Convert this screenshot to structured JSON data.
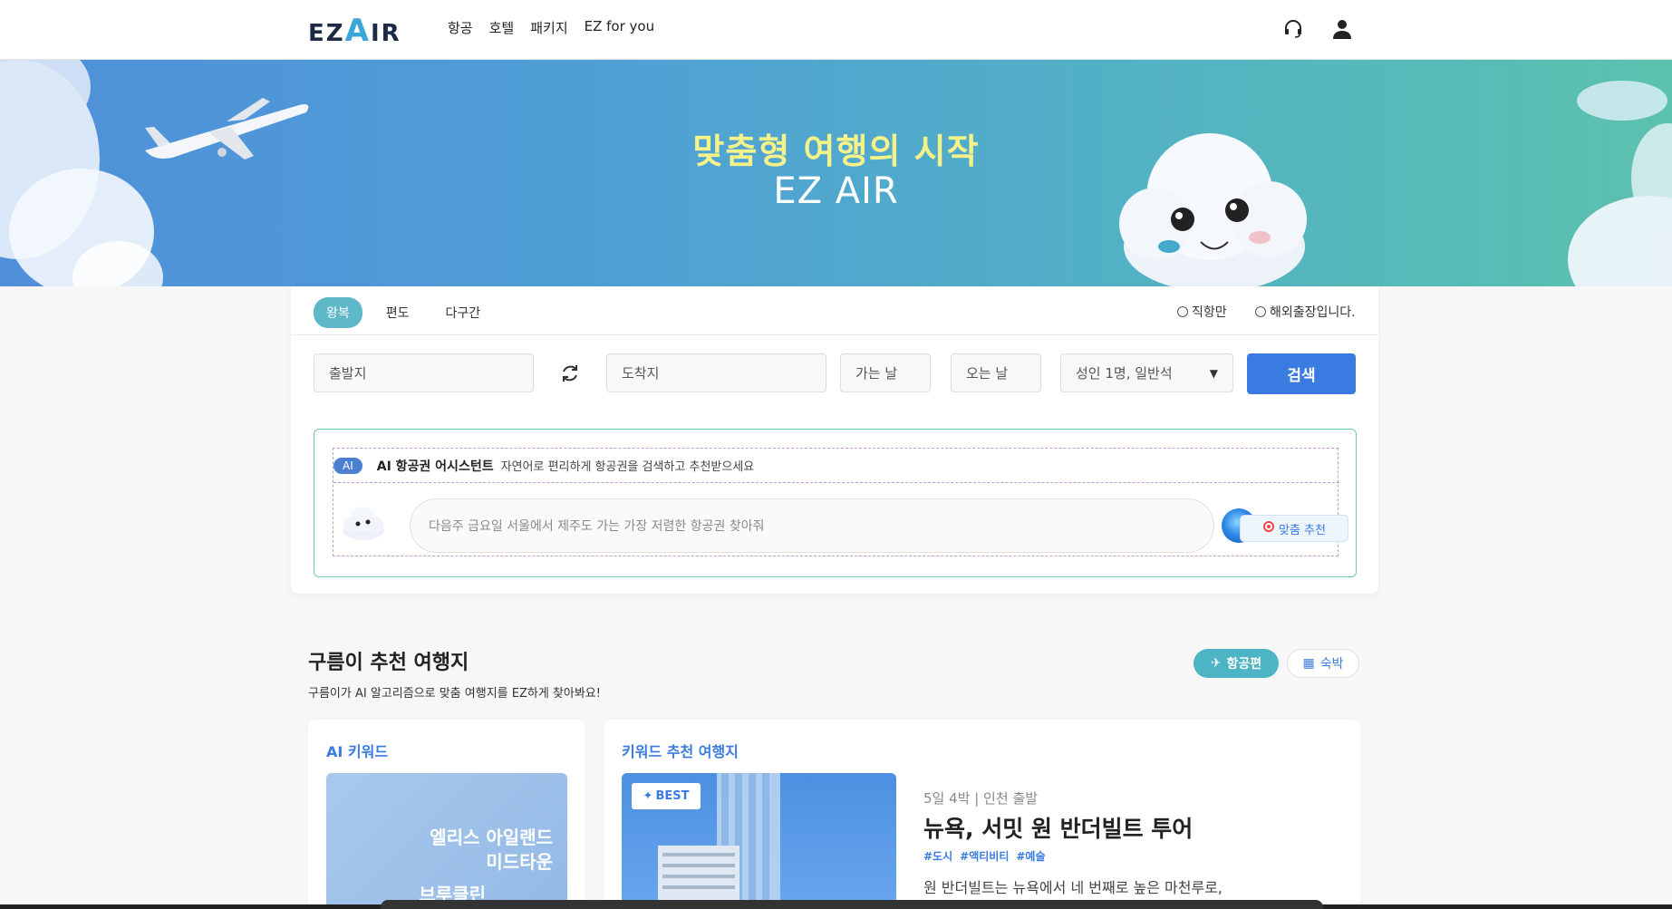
{
  "header": {
    "logo": "EZAIR",
    "nav": [
      "항공",
      "호텔",
      "패키지",
      "EZ for you"
    ],
    "icons": [
      "headset-icon",
      "user-icon"
    ]
  },
  "hero": {
    "title": "맞춤형 여행의 시작",
    "subtitle": "EZ AIR"
  },
  "search": {
    "tabs": [
      "왕복",
      "편도",
      "다구간"
    ],
    "active_tab": "왕복",
    "options": [
      "직항만",
      "해외출장입니다."
    ],
    "departure_placeholder": "출발지",
    "arrival_placeholder": "도착지",
    "depart_date": "가는 날",
    "return_date": "오는 날",
    "passengers": "성인 1명, 일반석",
    "search_label": "검색"
  },
  "ai": {
    "badge": "AI",
    "title": "AI 항공권 어시스턴트",
    "description": "자연어로 편리하게 항공권을 검색하고 추천받으세요",
    "placeholder": "다음주 금요일 서울에서 제주도 가는 가장 저렴한 항공권 찾아줘",
    "recommend_label": "맞춤 추천"
  },
  "section": {
    "title": "구름이 추천 여행지",
    "description": "구름이가 AI 알고리즘으로 맞춤 여행지를 EZ하게 찾아봐요!",
    "toggle": [
      "항공편",
      "숙박"
    ],
    "active_toggle": "항공편"
  },
  "keyword_panel": {
    "title": "AI 키워드",
    "keywords": [
      "엘리스 아일랜드",
      "미드타운",
      "브루클린"
    ]
  },
  "dest_panel": {
    "title": "키워드 추천 여행지",
    "badge": "BEST",
    "meta": "5일 4박 | 인천 출발",
    "name": "뉴욕, 서밋 원 반더빌트 투어",
    "tags": [
      "#도시",
      "#액티비티",
      "#예술"
    ],
    "description": "원 반더빌트는 뉴욕에서 네 번째로 높은 마천루로,"
  },
  "colors": {
    "accent_blue": "#3a7be2",
    "accent_teal": "#5fb8c7",
    "hero_title": "#f5f28a"
  }
}
